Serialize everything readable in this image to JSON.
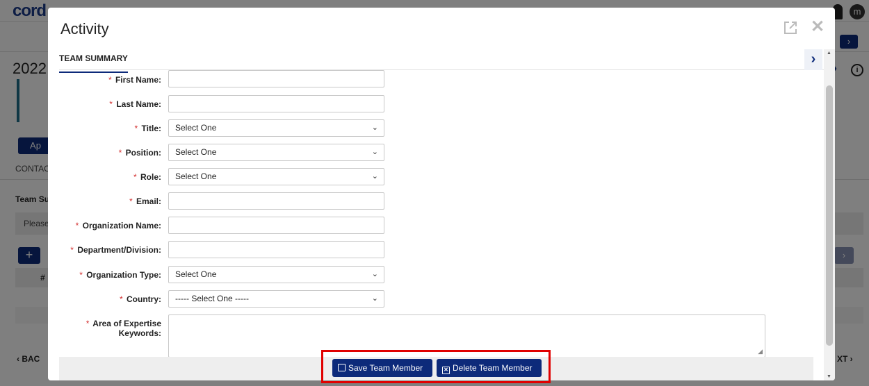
{
  "background": {
    "logo": "cord",
    "user_initial": "m",
    "year": "2022",
    "apply_button": "Ap",
    "contact_tab": "CONTAC",
    "team_summary": "Team Su",
    "please_text": "Please",
    "add_button": "+",
    "hash_col": "#",
    "back_button": "BAC",
    "next_button": "XT",
    "info_icon": "i"
  },
  "modal": {
    "title": "Activity",
    "tab_label": "TEAM SUMMARY",
    "fields": [
      {
        "label": "First Name:",
        "value": ""
      },
      {
        "label": "Last Name:",
        "value": ""
      },
      {
        "label": "Title:",
        "value": "Select One"
      },
      {
        "label": "Position:",
        "value": "Select One"
      },
      {
        "label": "Role:",
        "value": "Select One"
      },
      {
        "label": "Email:",
        "value": ""
      },
      {
        "label": "Organization Name:",
        "value": ""
      },
      {
        "label": "Department/Division:",
        "value": ""
      },
      {
        "label": "Organization Type:",
        "value": "Select One"
      },
      {
        "label": "Country:",
        "value": "----- Select One -----"
      },
      {
        "label": "Area of Expertise Keywords:",
        "value": ""
      }
    ],
    "required_marker": "*",
    "buttons": {
      "save": "Save Team Member",
      "delete": "Delete Team Member"
    }
  },
  "colors": {
    "primary": "#0d2a7a",
    "required": "#d32f2f",
    "highlight": "#e00000"
  }
}
